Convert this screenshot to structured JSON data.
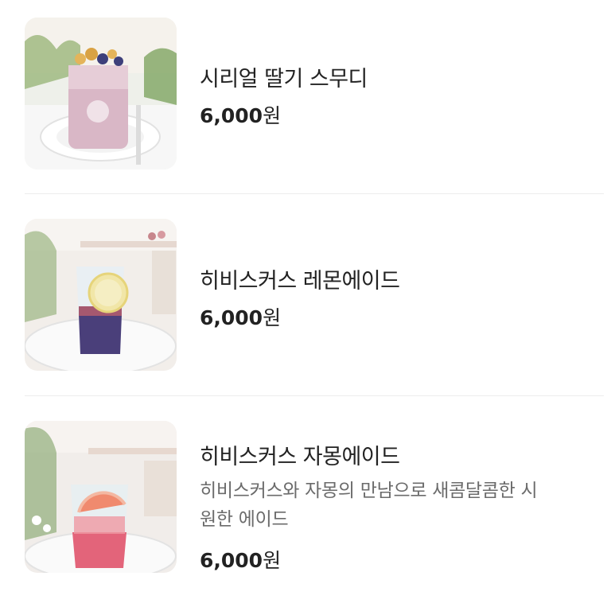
{
  "menu": {
    "items": [
      {
        "name": "시리얼 딸기 스무디",
        "description": "",
        "price_number": "6,000",
        "price_unit": "원",
        "image_icon": "cereal-strawberry-smoothie-photo"
      },
      {
        "name": "히비스커스 레몬에이드",
        "description": "",
        "price_number": "6,000",
        "price_unit": "원",
        "image_icon": "hibiscus-lemonade-photo"
      },
      {
        "name": "히비스커스 자몽에이드",
        "description_line1": "히비스커스와 자몽의 만남으로 새콤달콤한 시",
        "description_line2": "원한 에이드",
        "price_number": "6,000",
        "price_unit": "원",
        "image_icon": "hibiscus-grapefruit-ade-photo"
      }
    ]
  }
}
